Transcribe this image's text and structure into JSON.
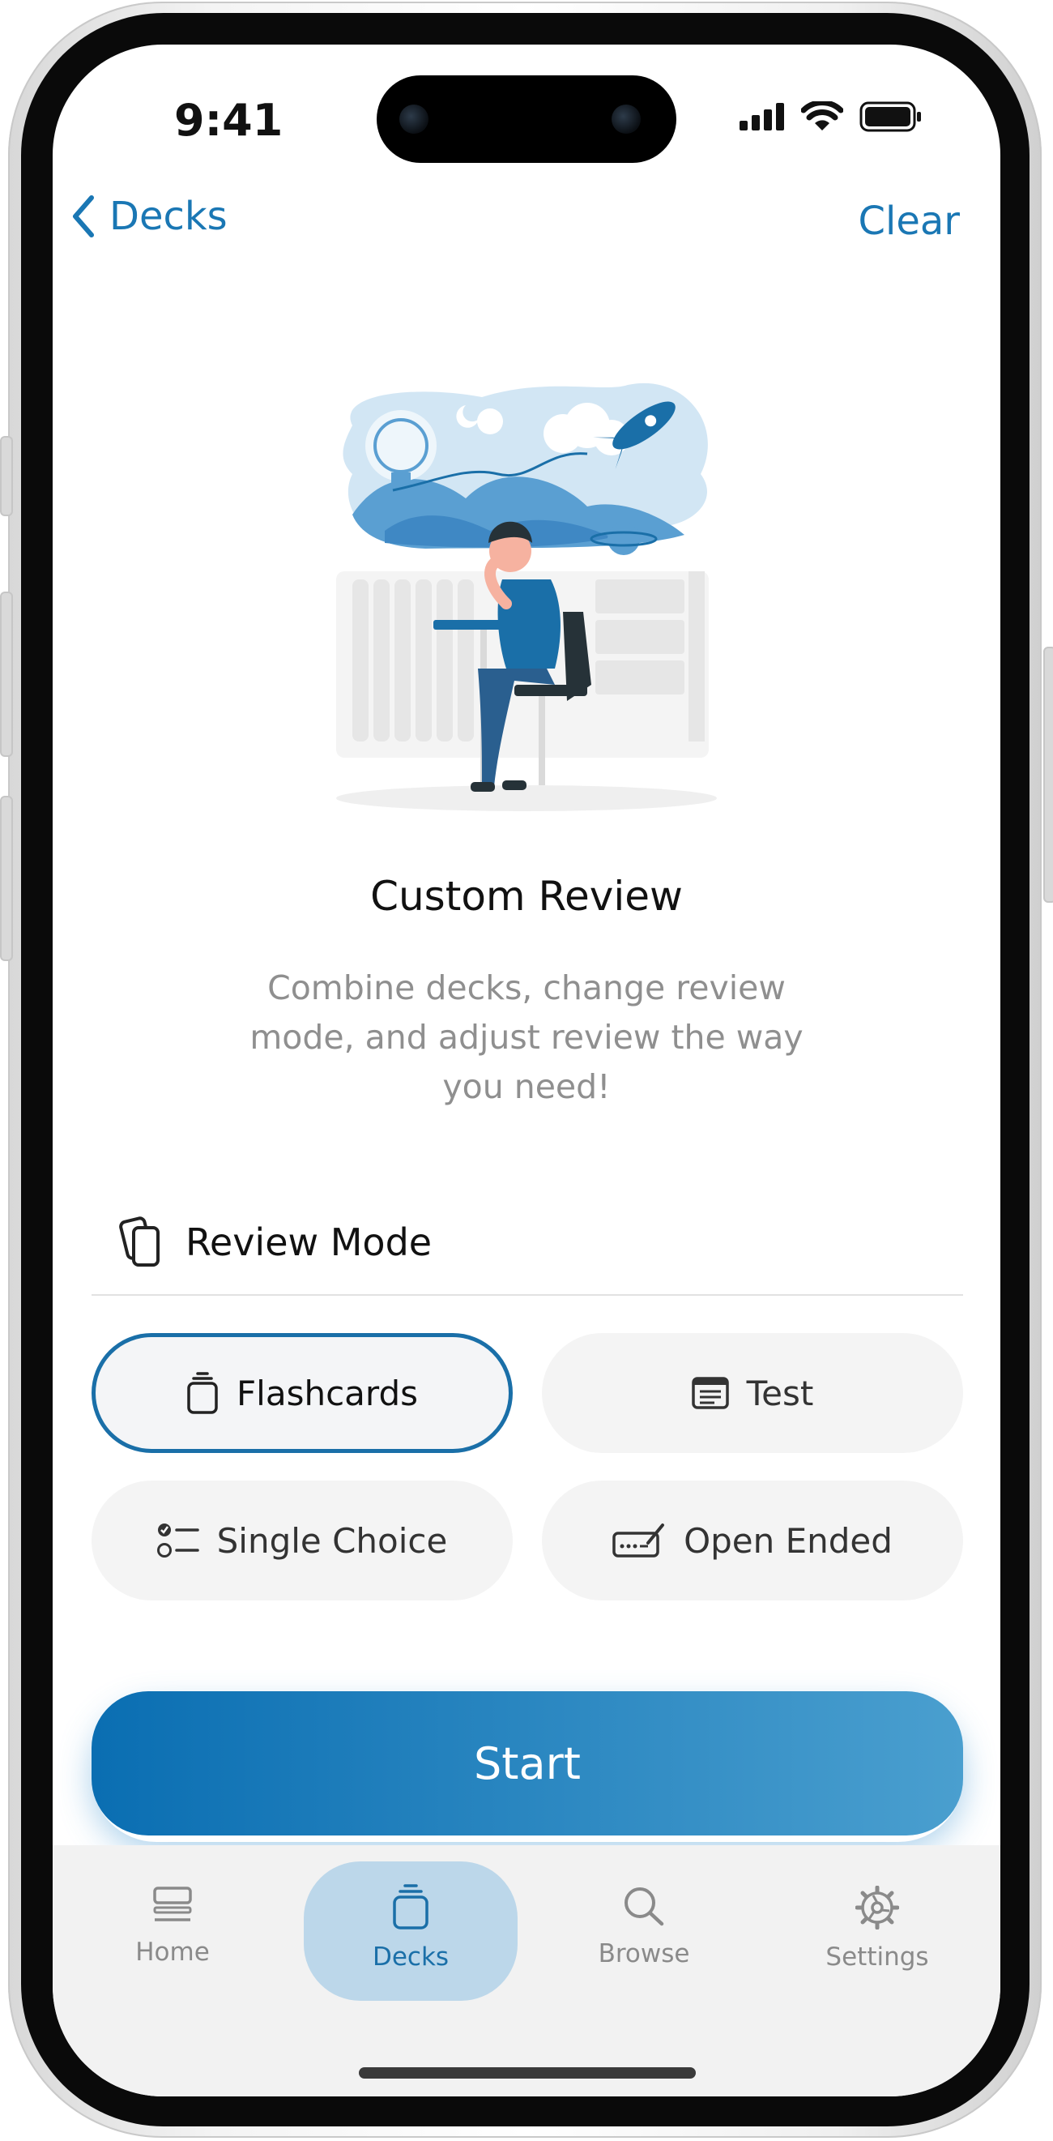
{
  "status_bar": {
    "time": "9:41"
  },
  "nav": {
    "back_label": "Decks",
    "clear_label": "Clear"
  },
  "hero": {
    "title": "Custom Review",
    "description": "Combine decks, change review mode, and adjust review the way you need!"
  },
  "review_mode": {
    "label": "Review Mode",
    "modes": [
      {
        "label": "Flashcards",
        "icon": "flashcards-icon",
        "selected": true
      },
      {
        "label": "Test",
        "icon": "test-icon",
        "selected": false
      },
      {
        "label": "Single Choice",
        "icon": "single-choice-icon",
        "selected": false
      },
      {
        "label": "Open Ended",
        "icon": "open-ended-icon",
        "selected": false
      }
    ]
  },
  "start_button": {
    "label": "Start"
  },
  "tab_bar": {
    "tabs": [
      {
        "label": "Home",
        "icon": "home-icon",
        "active": false
      },
      {
        "label": "Decks",
        "icon": "decks-icon",
        "active": true
      },
      {
        "label": "Browse",
        "icon": "search-icon",
        "active": false
      },
      {
        "label": "Settings",
        "icon": "gear-icon",
        "active": false
      }
    ]
  },
  "colors": {
    "accent": "#1a77b4",
    "active_tab_bg": "#bcd7ea",
    "start_gradient": [
      "#0a6eb2",
      "#4a9fcf"
    ]
  }
}
